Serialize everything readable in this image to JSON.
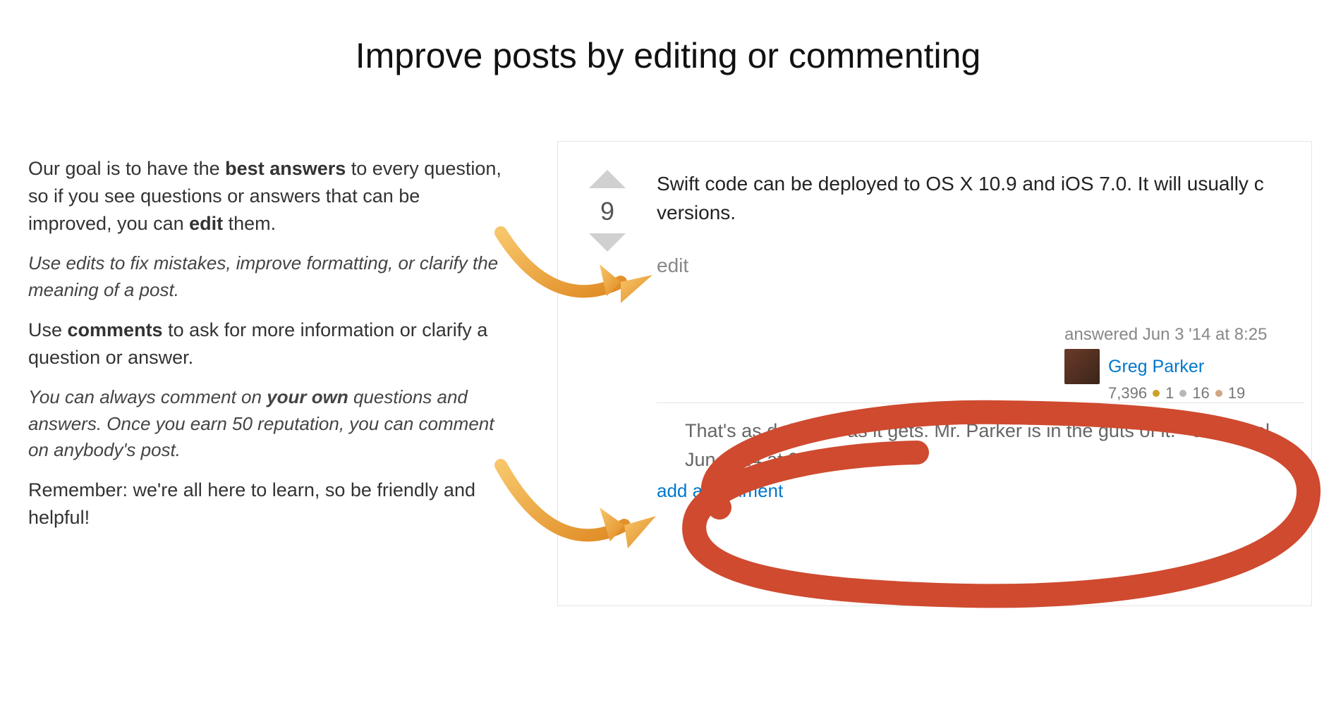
{
  "title": "Improve posts by editing or commenting",
  "intro": {
    "para1_part1": "Our goal is to have the ",
    "para1_bold1": "best answers",
    "para1_part2": " to every question, so if you see questions or answers that can be improved, you can ",
    "para1_bold2": "edit",
    "para1_part3": " them.",
    "hint1": "Use edits to fix mistakes, improve formatting, or clarify the meaning of a post."
  },
  "comments_block": {
    "para2_part1": "Use ",
    "para2_bold1": "comments",
    "para2_part2": " to ask for more information or clarify a question or answer.",
    "hint2_part1": "You can always comment on ",
    "hint2_bold": "your own",
    "hint2_part2": " questions and answers. Once you earn 50 reputation, you can comment on anybody's post.",
    "closing": "Remember: we're all here to learn, so be friendly and helpful!"
  },
  "answer_panel": {
    "vote_count": "9",
    "body_line1": "Swift code can be deployed to OS X 10.9 and iOS 7.0. It will usually c",
    "body_line2": "versions.",
    "edit_label": "edit",
    "answered_text": "answered Jun 3 '14 at 8:25",
    "username": "Greg Parker",
    "rep": "7,396",
    "gold": "1",
    "silver": "16",
    "bronze": "19",
    "comment_line1": "That's as definitive as it gets. Mr. Parker is in the guts of it. - uchuugal",
    "comment_line2": "Jun 3 '14 at 9:27",
    "add_comment_label": "add a comment"
  }
}
